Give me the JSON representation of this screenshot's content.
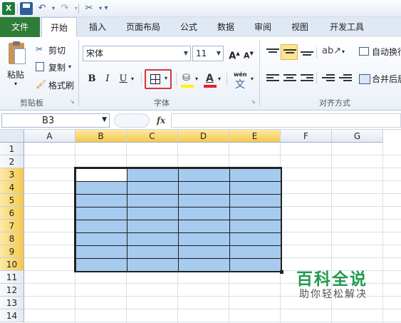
{
  "qat": {
    "app_logo": "X",
    "icons": [
      "excel-logo",
      "save-icon",
      "undo-icon",
      "redo-icon",
      "tools-icon",
      "customize-icon"
    ]
  },
  "tabs": [
    {
      "label": "文件"
    },
    {
      "label": "开始"
    },
    {
      "label": "插入"
    },
    {
      "label": "页面布局"
    },
    {
      "label": "公式"
    },
    {
      "label": "数据"
    },
    {
      "label": "审阅"
    },
    {
      "label": "视图"
    },
    {
      "label": "开发工具"
    }
  ],
  "ribbon": {
    "clipboard": {
      "paste": "粘贴",
      "cut": "剪切",
      "copy": "复制",
      "format_painter": "格式刷",
      "group": "剪贴板"
    },
    "font": {
      "font_name": "宋体",
      "font_size": "11",
      "bold": "B",
      "italic": "I",
      "underline": "U",
      "grow": "A",
      "shrink": "A",
      "font_color": "A",
      "phonetic": "wén",
      "group": "字体"
    },
    "alignment": {
      "wrap_text": "自动换行",
      "merge_center": "合并后居",
      "group": "对齐方式"
    }
  },
  "formula_bar": {
    "name_box": "B3",
    "fx": "fx",
    "value": ""
  },
  "columns": [
    "A",
    "B",
    "C",
    "D",
    "E",
    "F",
    "G"
  ],
  "selected_columns": [
    "B",
    "C",
    "D",
    "E"
  ],
  "rows": [
    "1",
    "2",
    "3",
    "4",
    "5",
    "6",
    "7",
    "8",
    "9",
    "10",
    "11",
    "12",
    "13",
    "14"
  ],
  "selected_rows": [
    "3",
    "4",
    "5",
    "6",
    "7",
    "8",
    "9",
    "10"
  ],
  "selection": {
    "range": "B3:E10",
    "active_cell": "B3",
    "fill_color": "#a7cbef"
  },
  "watermark": {
    "title": "百科全说",
    "subtitle": "助你轻松解决"
  }
}
